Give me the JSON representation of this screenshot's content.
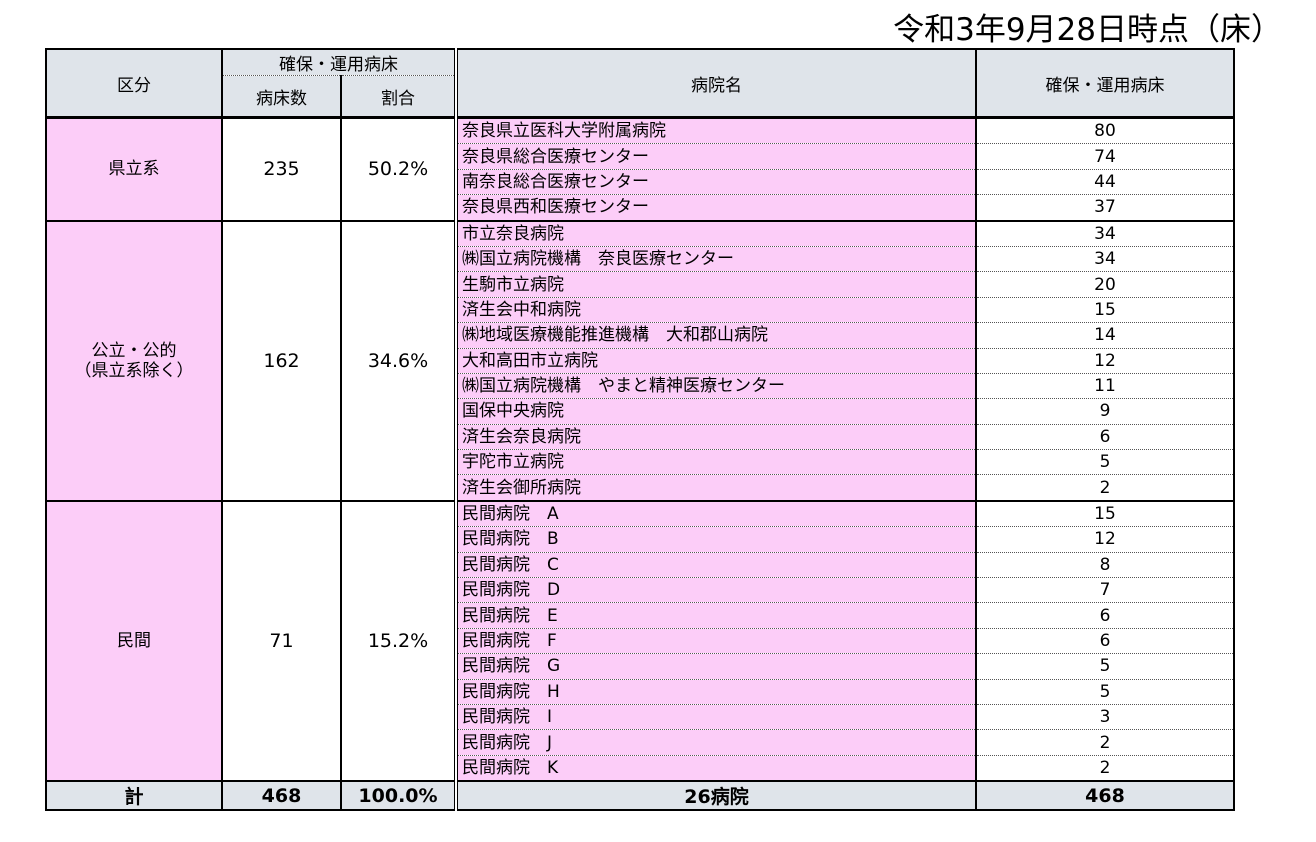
{
  "as_of": "令和3年9月28日時点（床）",
  "header": {
    "category": "区分",
    "secured_group": "確保・運用病床",
    "beds_count": "病床数",
    "ratio": "割合",
    "hospital_name": "病院名",
    "hospital_beds": "確保・運用病床"
  },
  "groups": [
    {
      "category": "県立系",
      "beds": "235",
      "ratio": "50.2%",
      "hospitals": [
        {
          "name": "奈良県立医科大学附属病院",
          "beds": "80"
        },
        {
          "name": "奈良県総合医療センター",
          "beds": "74"
        },
        {
          "name": "南奈良総合医療センター",
          "beds": "44"
        },
        {
          "name": "奈良県西和医療センター",
          "beds": "37"
        }
      ]
    },
    {
      "category": "公立・公的\n（県立系除く）",
      "beds": "162",
      "ratio": "34.6%",
      "hospitals": [
        {
          "name": "市立奈良病院",
          "beds": "34"
        },
        {
          "name": "㈱国立病院機構　奈良医療センター",
          "beds": "34"
        },
        {
          "name": "生駒市立病院",
          "beds": "20"
        },
        {
          "name": "済生会中和病院",
          "beds": "15"
        },
        {
          "name": "㈱地域医療機能推進機構　大和郡山病院",
          "beds": "14"
        },
        {
          "name": "大和高田市立病院",
          "beds": "12"
        },
        {
          "name": "㈱国立病院機構　やまと精神医療センター",
          "beds": "11"
        },
        {
          "name": "国保中央病院",
          "beds": "9"
        },
        {
          "name": "済生会奈良病院",
          "beds": "6"
        },
        {
          "name": "宇陀市立病院",
          "beds": "5"
        },
        {
          "name": "済生会御所病院",
          "beds": "2"
        }
      ]
    },
    {
      "category": "民間",
      "beds": "71",
      "ratio": "15.2%",
      "hospitals": [
        {
          "name": "民間病院　A",
          "beds": "15"
        },
        {
          "name": "民間病院　B",
          "beds": "12"
        },
        {
          "name": "民間病院　C",
          "beds": "8"
        },
        {
          "name": "民間病院　D",
          "beds": "7"
        },
        {
          "name": "民間病院　E",
          "beds": "6"
        },
        {
          "name": "民間病院　F",
          "beds": "6"
        },
        {
          "name": "民間病院　G",
          "beds": "5"
        },
        {
          "name": "民間病院　H",
          "beds": "5"
        },
        {
          "name": "民間病院　I",
          "beds": "3"
        },
        {
          "name": "民間病院　J",
          "beds": "2"
        },
        {
          "name": "民間病院　K",
          "beds": "2"
        }
      ]
    }
  ],
  "total": {
    "label": "計",
    "beds": "468",
    "ratio": "100.0%",
    "hospital_count": "26病院",
    "hospital_beds": "468"
  },
  "colors": {
    "header_bg": "#dfe4ea",
    "pink_bg": "#fccdf8"
  }
}
